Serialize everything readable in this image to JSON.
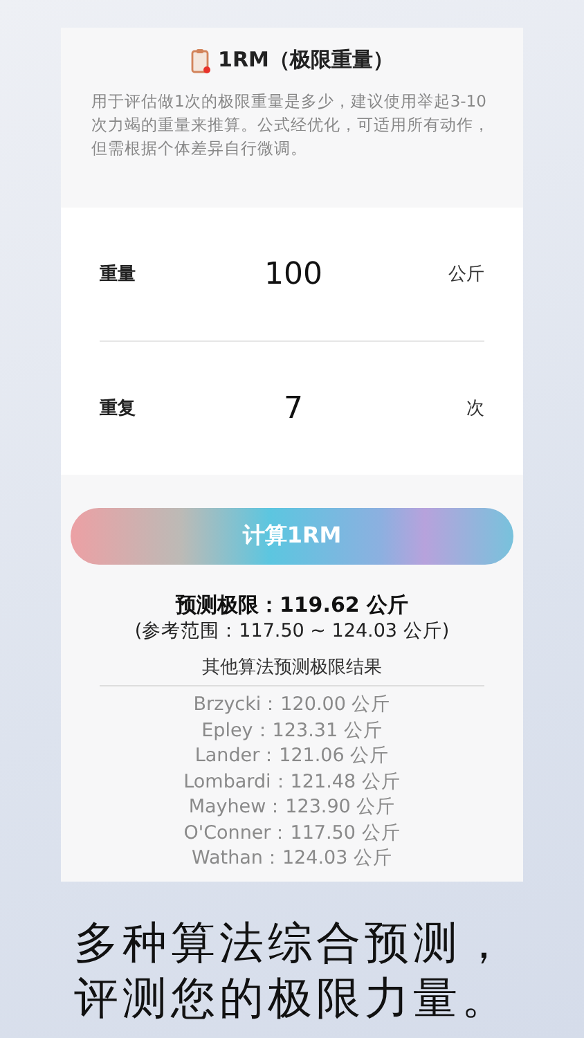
{
  "header": {
    "title": "1RM（极限重量）",
    "description": "用于评估做1次的极限重量是多少，建议使用举起3-10次力竭的重量来推算。公式经优化，可适用所有动作，但需根据个体差异自行微调。"
  },
  "inputs": [
    {
      "label": "重量",
      "value": "100",
      "unit": "公斤"
    },
    {
      "label": "重复",
      "value": "7",
      "unit": "次"
    }
  ],
  "calculate_button": "计算1RM",
  "result": {
    "prediction": "预测极限：119.62 公斤",
    "range": "(参考范围：117.50 ~ 124.03 公斤)",
    "others_title": "其他算法预测极限结果",
    "others": [
      "Brzycki：120.00 公斤",
      "Epley：123.31 公斤",
      "Lander：121.06 公斤",
      "Lombardi：121.48 公斤",
      "Mayhew：123.90 公斤",
      "O'Conner：117.50 公斤",
      "Wathan：124.03 公斤"
    ]
  },
  "caption": [
    "多种算法综合预测，",
    "评测您的极限力量。"
  ]
}
